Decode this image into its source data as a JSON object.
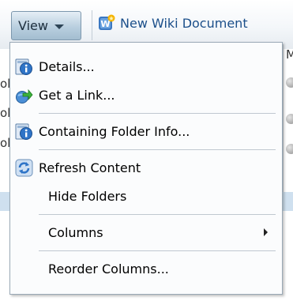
{
  "toolbar": {
    "view_label": "View",
    "new_wiki_label": "New Wiki Document"
  },
  "background": {
    "col_header_partial": "M",
    "row_fragments": [
      "ol",
      "ol",
      "ol"
    ]
  },
  "menu": {
    "items": [
      {
        "label": "Details...",
        "icon": "info-icon"
      },
      {
        "label": "Get a Link...",
        "icon": "link-arrow-icon"
      },
      {
        "label": "Containing Folder Info...",
        "icon": "info-icon"
      },
      {
        "label": "Refresh Content",
        "icon": "refresh-icon"
      },
      {
        "label": "Hide Folders",
        "icon": null
      },
      {
        "label": "Columns",
        "icon": null,
        "submenu": true
      },
      {
        "label": "Reorder Columns...",
        "icon": null
      }
    ]
  },
  "colors": {
    "menu_bg": "#fbfcfd",
    "menu_border": "#9aa9b6",
    "link_blue": "#1b4f8a",
    "info_blue": "#2f74c7",
    "link_green": "#34a534",
    "selection_row": "#cfe0ef"
  }
}
